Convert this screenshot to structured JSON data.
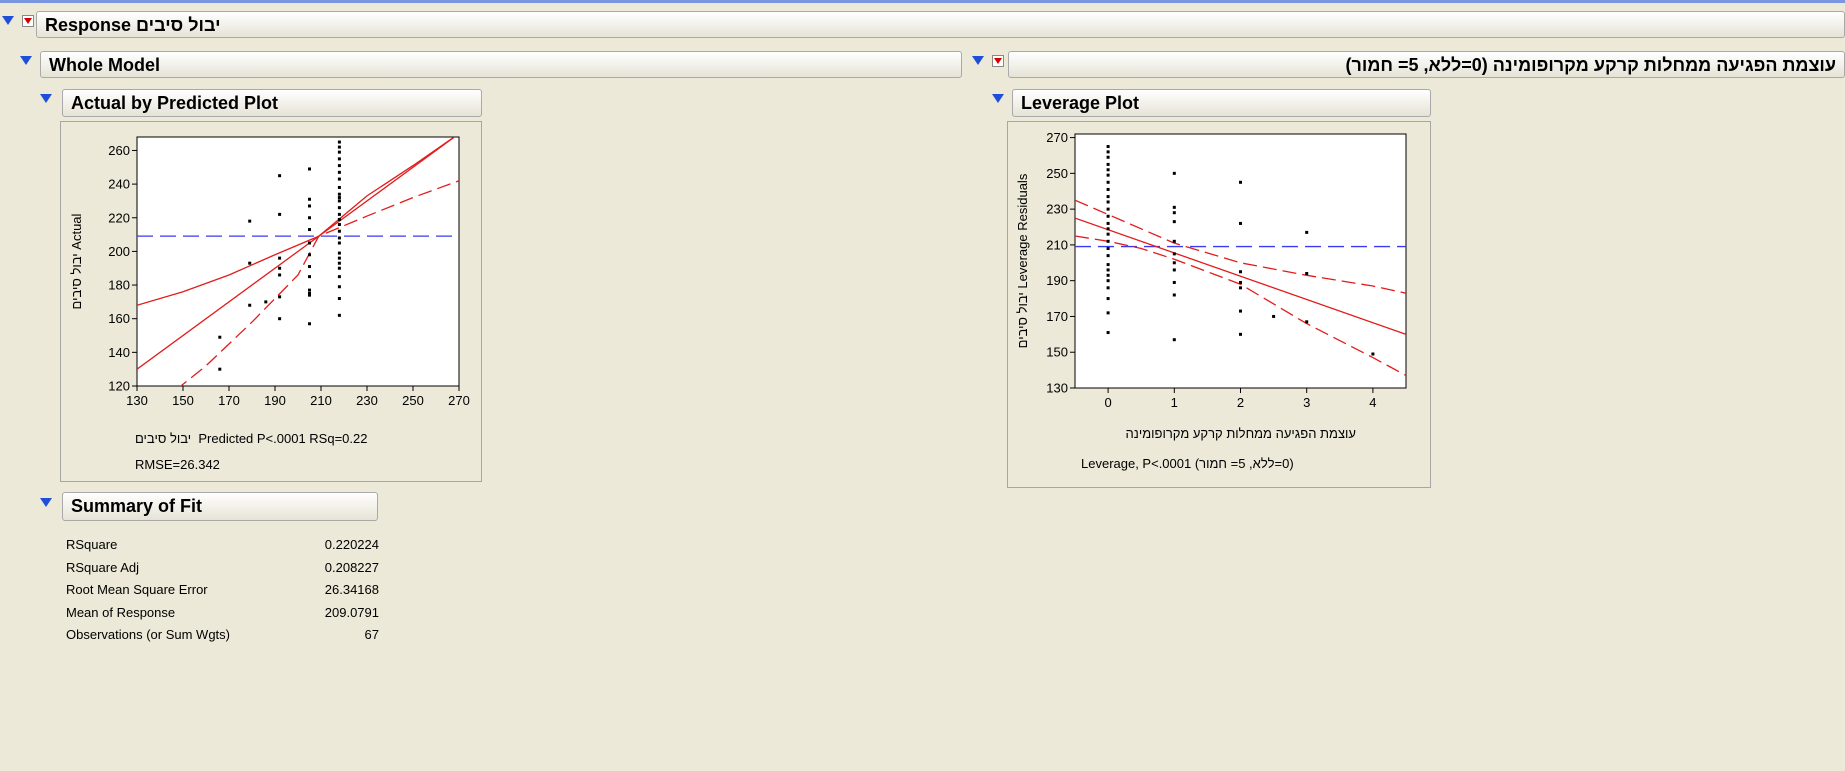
{
  "response_header": "יבול סיבים Response",
  "whole_model": {
    "title": "Whole Model"
  },
  "factor_header": "עוצמת הפגיעה ממחלות קרקע מקרופומינה (0=ללא, 5= חמור)",
  "actual_plot": {
    "title": "Actual by Predicted Plot",
    "caption_line1_he": "יבול סיבים",
    "caption_line1": "Predicted P<.0001 RSq=0.22",
    "caption_line2": "RMSE=26.342"
  },
  "leverage_plot": {
    "title": "Leverage Plot",
    "caption_line1": "עוצמת הפגיעה ממחלות קרקע מקרופומינה",
    "caption_line2": "(0=ללא, 5= חמור) Leverage, P<.0001"
  },
  "summary_of_fit": {
    "title": "Summary of Fit",
    "rows": [
      {
        "label": "RSquare",
        "value": "0.220224"
      },
      {
        "label": "RSquare Adj",
        "value": "0.208227"
      },
      {
        "label": "Root Mean Square Error",
        "value": "26.34168"
      },
      {
        "label": "Mean of Response",
        "value": "209.0791"
      },
      {
        "label": "Observations (or Sum Wgts)",
        "value": "67"
      }
    ]
  },
  "chart_data": [
    {
      "type": "scatter",
      "title": "Actual by Predicted Plot",
      "ylabel": "יבול סיבים Actual",
      "xlabel": "יבול סיבים Predicted P<.0001 RSq=0.22",
      "xlim": [
        130,
        270
      ],
      "ylim": [
        120,
        268
      ],
      "x_ticks": [
        130,
        150,
        170,
        190,
        210,
        230,
        250,
        270
      ],
      "y_ticks": [
        120,
        140,
        160,
        180,
        200,
        220,
        240,
        260
      ],
      "mean_line": 209.08,
      "fit_line": [
        [
          130,
          130
        ],
        [
          270,
          270
        ]
      ],
      "conf_upper": [
        [
          130,
          168
        ],
        [
          150,
          176
        ],
        [
          170,
          186
        ],
        [
          190,
          198
        ],
        [
          209,
          209
        ],
        [
          230,
          233
        ],
        [
          250,
          251
        ],
        [
          270,
          270
        ]
      ],
      "conf_lower": [
        [
          140,
          110
        ],
        [
          160,
          132
        ],
        [
          180,
          158
        ],
        [
          200,
          186
        ],
        [
          209,
          209
        ],
        [
          230,
          221
        ],
        [
          250,
          232
        ],
        [
          270,
          242
        ]
      ],
      "points": [
        [
          166,
          149
        ],
        [
          166,
          130
        ],
        [
          179,
          218
        ],
        [
          179,
          193
        ],
        [
          179,
          168
        ],
        [
          186,
          170
        ],
        [
          192,
          245
        ],
        [
          192,
          222
        ],
        [
          192,
          196
        ],
        [
          192,
          190
        ],
        [
          192,
          186
        ],
        [
          192,
          173
        ],
        [
          192,
          160
        ],
        [
          205,
          249
        ],
        [
          205,
          231
        ],
        [
          205,
          227
        ],
        [
          205,
          220
        ],
        [
          205,
          213
        ],
        [
          205,
          205
        ],
        [
          205,
          198
        ],
        [
          205,
          191
        ],
        [
          205,
          185
        ],
        [
          205,
          177
        ],
        [
          205,
          175
        ],
        [
          205,
          174
        ],
        [
          205,
          157
        ],
        [
          218,
          265
        ],
        [
          218,
          262
        ],
        [
          218,
          259
        ],
        [
          218,
          255
        ],
        [
          218,
          251
        ],
        [
          218,
          247
        ],
        [
          218,
          243
        ],
        [
          218,
          238
        ],
        [
          218,
          234
        ],
        [
          218,
          232
        ],
        [
          218,
          230
        ],
        [
          218,
          226
        ],
        [
          218,
          222
        ],
        [
          218,
          219
        ],
        [
          218,
          216
        ],
        [
          218,
          212
        ],
        [
          218,
          208
        ],
        [
          218,
          205
        ],
        [
          218,
          199
        ],
        [
          218,
          196
        ],
        [
          218,
          193
        ],
        [
          218,
          190
        ],
        [
          218,
          185
        ],
        [
          218,
          179
        ],
        [
          218,
          172
        ],
        [
          218,
          162
        ]
      ]
    },
    {
      "type": "scatter",
      "title": "Leverage Plot",
      "ylabel": "יבול סיבים Leverage Residuals",
      "xlabel": "עוצמת הפגיעה ממחלות קרקע מקרופומינה (0=ללא, 5= חמור) Leverage, P<.0001",
      "xlim": [
        -0.5,
        4.5
      ],
      "ylim": [
        130,
        272
      ],
      "x_ticks": [
        0,
        1,
        2,
        3,
        4
      ],
      "y_ticks": [
        130,
        150,
        170,
        190,
        210,
        230,
        250,
        270
      ],
      "mean_line": 209.08,
      "fit_line": [
        [
          -0.5,
          225
        ],
        [
          4.5,
          160
        ]
      ],
      "conf_upper": [
        [
          -0.5,
          235
        ],
        [
          0,
          227
        ],
        [
          0.5,
          219
        ],
        [
          1,
          211
        ],
        [
          2,
          200
        ],
        [
          3,
          193
        ],
        [
          4,
          187
        ],
        [
          4.5,
          183
        ]
      ],
      "conf_lower": [
        [
          -0.5,
          215
        ],
        [
          0,
          212
        ],
        [
          0.5,
          208
        ],
        [
          1,
          202
        ],
        [
          2,
          188
        ],
        [
          3,
          166
        ],
        [
          4,
          147
        ],
        [
          4.5,
          137
        ]
      ],
      "points": [
        [
          0,
          265
        ],
        [
          0,
          262
        ],
        [
          0,
          259
        ],
        [
          0,
          255
        ],
        [
          0,
          252
        ],
        [
          0,
          249
        ],
        [
          0,
          245
        ],
        [
          0,
          241
        ],
        [
          0,
          237
        ],
        [
          0,
          234
        ],
        [
          0,
          230
        ],
        [
          0,
          226
        ],
        [
          0,
          222
        ],
        [
          0,
          219
        ],
        [
          0,
          216
        ],
        [
          0,
          212
        ],
        [
          0,
          208
        ],
        [
          0,
          204
        ],
        [
          0,
          199
        ],
        [
          0,
          196
        ],
        [
          0,
          193
        ],
        [
          0,
          190
        ],
        [
          0,
          186
        ],
        [
          0,
          180
        ],
        [
          0,
          172
        ],
        [
          0,
          161
        ],
        [
          1,
          250
        ],
        [
          1,
          231
        ],
        [
          1,
          228
        ],
        [
          1,
          223
        ],
        [
          1,
          212
        ],
        [
          1,
          205
        ],
        [
          1,
          200
        ],
        [
          1,
          196
        ],
        [
          1,
          189
        ],
        [
          1,
          182
        ],
        [
          1,
          157
        ],
        [
          2,
          245
        ],
        [
          2,
          222
        ],
        [
          2,
          195
        ],
        [
          2,
          189
        ],
        [
          2,
          186
        ],
        [
          2,
          173
        ],
        [
          2,
          160
        ],
        [
          2.5,
          170
        ],
        [
          3,
          217
        ],
        [
          3,
          194
        ],
        [
          3,
          167
        ],
        [
          4,
          149
        ]
      ]
    }
  ]
}
